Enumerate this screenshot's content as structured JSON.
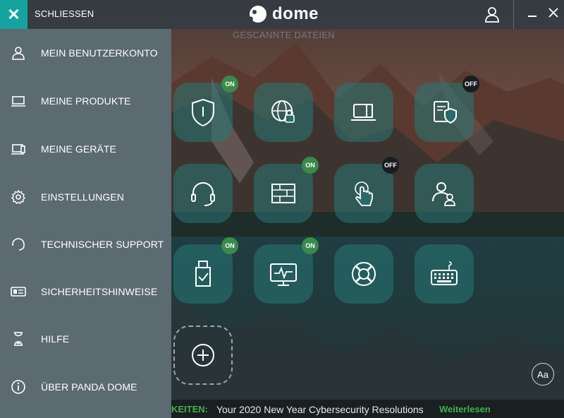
{
  "titlebar": {
    "close_label": "SCHLIESSEN",
    "logo_text": "dome",
    "close_glyph": "✕"
  },
  "header": {
    "scanned_label": "GESCANNTE DATEIEN"
  },
  "menu": {
    "items": [
      {
        "label": "MEIN BENUTZERKONTO",
        "icon": "user-icon"
      },
      {
        "label": "MEINE PRODUKTE",
        "icon": "laptop-icon"
      },
      {
        "label": "MEINE GERÄTE",
        "icon": "devices-icon"
      },
      {
        "label": "EINSTELLUNGEN",
        "icon": "gear-icon"
      },
      {
        "label": "TECHNISCHER SUPPORT",
        "icon": "headset-icon"
      },
      {
        "label": "SICHERHEITSHINWEISE",
        "icon": "alert-card-icon"
      },
      {
        "label": "HILFE",
        "icon": "hourglass-icon"
      },
      {
        "label": "ÜBER PANDA DOME",
        "icon": "info-icon"
      }
    ]
  },
  "tiles": {
    "antivirus": {
      "status": "ON"
    },
    "web_protection": {
      "status": ""
    },
    "laptop": {
      "status": ""
    },
    "data_shield": {
      "status": "OFF"
    },
    "support": {
      "status": ""
    },
    "firewall": {
      "status": "ON"
    },
    "touch": {
      "status": "OFF"
    },
    "family": {
      "status": ""
    },
    "usb": {
      "status": "ON"
    },
    "monitor": {
      "status": "ON"
    },
    "rescue": {
      "status": ""
    },
    "keyboard": {
      "status": ""
    }
  },
  "news": {
    "tag": "KEITEN:",
    "text": "Your 2020 New Year Cybersecurity Resolutions",
    "link": "Weiterlesen"
  },
  "font_button": "Aa",
  "colors": {
    "accent": "#15a3a0",
    "menu_bg": "#5c6a72",
    "on_badge": "#3a8a4a",
    "off_badge": "#1a1d1f",
    "news_green": "#3fb34f"
  }
}
